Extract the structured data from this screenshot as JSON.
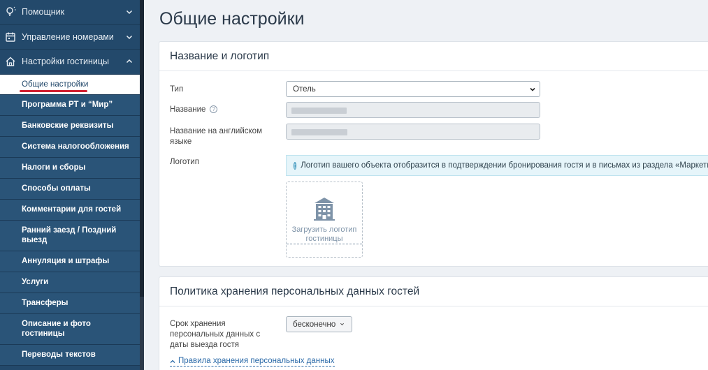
{
  "sidebar": {
    "groups": [
      {
        "label": "Помощник",
        "icon": "lightbulb-icon",
        "expanded": false
      },
      {
        "label": "Управление номерами",
        "icon": "calendar-icon",
        "expanded": false
      },
      {
        "label": "Настройки гостиницы",
        "icon": "home-icon",
        "expanded": true
      }
    ],
    "items": [
      {
        "label": "Общие настройки",
        "active": true
      },
      {
        "label": "Программа РТ и “Мир”"
      },
      {
        "label": "Банковские реквизиты"
      },
      {
        "label": "Система налогообложения"
      },
      {
        "label": "Налоги и сборы"
      },
      {
        "label": "Способы оплаты"
      },
      {
        "label": "Комментарии для гостей"
      },
      {
        "label": "Ранний заезд / Поздний выезд"
      },
      {
        "label": "Аннуляция и штрафы"
      },
      {
        "label": "Услуги"
      },
      {
        "label": "Трансферы"
      },
      {
        "label": "Описание и фото гостиницы"
      },
      {
        "label": "Переводы текстов"
      }
    ]
  },
  "main": {
    "title": "Общие настройки",
    "name_logo": {
      "header": "Название и логотип",
      "type_label": "Тип",
      "type_value": "Отель",
      "name_label": "Название",
      "name_en_label": "Название на английском языке",
      "logo_label": "Логотип",
      "logo_info": "Логотип вашего объекта отобразится в подтверждении бронирования гостя и в письмах из раздела «Маркетинг».",
      "upload_label": "Загрузить логотип гостиницы"
    },
    "privacy": {
      "header": "Политика хранения персональных данных гостей",
      "retention_label": "Срок хранения персональных данных с даты выезда гостя",
      "retention_value": "бесконечно",
      "rules_link": "Правила хранения персональных данных"
    }
  },
  "colors": {
    "sidebar_bg": "#23496b",
    "sidebar_item_bg": "#2a5478",
    "active_underline": "#d32030",
    "link": "#2b6aa8",
    "info_bg": "#e6f5fa"
  }
}
